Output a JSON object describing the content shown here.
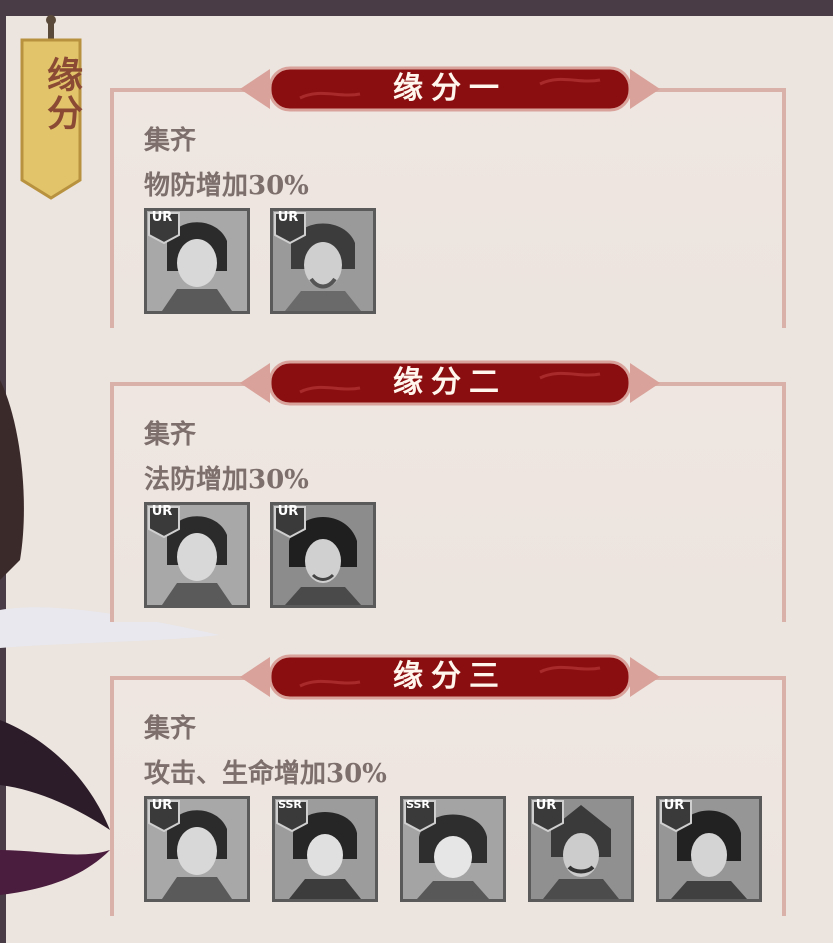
{
  "banner": {
    "label": "缘分"
  },
  "bonds": [
    {
      "title": "缘分一",
      "requirement": "集齐",
      "effect": "物防增加30%",
      "heroes": [
        {
          "rarity": "UR",
          "portrait": "hero-portrait-icon"
        },
        {
          "rarity": "UR",
          "portrait": "hero-portrait-icon"
        }
      ]
    },
    {
      "title": "缘分二",
      "requirement": "集齐",
      "effect": "法防增加30%",
      "heroes": [
        {
          "rarity": "UR",
          "portrait": "hero-portrait-icon"
        },
        {
          "rarity": "UR",
          "portrait": "hero-portrait-icon"
        }
      ]
    },
    {
      "title": "缘分三",
      "requirement": "集齐",
      "effect": "攻击、生命增加30%",
      "heroes": [
        {
          "rarity": "UR",
          "portrait": "hero-portrait-icon"
        },
        {
          "rarity": "SSR",
          "portrait": "hero-portrait-icon"
        },
        {
          "rarity": "SSR",
          "portrait": "hero-portrait-icon"
        },
        {
          "rarity": "UR",
          "portrait": "hero-portrait-icon"
        },
        {
          "rarity": "UR",
          "portrait": "hero-portrait-icon"
        }
      ]
    }
  ],
  "colors": {
    "background": "#ece4de",
    "title_bar": "#8a0e10",
    "banner_gold": "#e2c46a",
    "text_muted": "#7d6f6c"
  }
}
